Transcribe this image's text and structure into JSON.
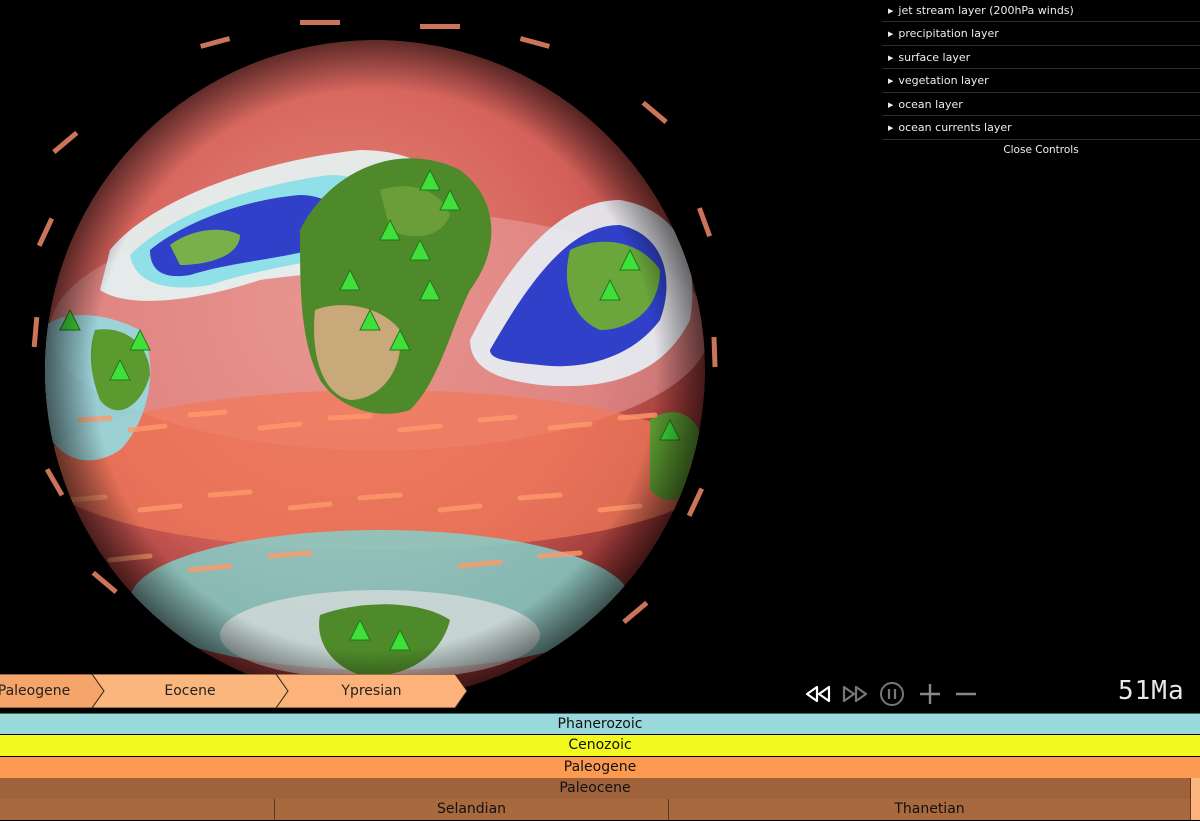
{
  "controls": {
    "layers": [
      {
        "label": "jet stream layer (200hPa winds)"
      },
      {
        "label": "precipitation layer"
      },
      {
        "label": "surface layer"
      },
      {
        "label": "vegetation layer"
      },
      {
        "label": "ocean layer"
      },
      {
        "label": "ocean currents layer"
      }
    ],
    "close_label": "Close Controls"
  },
  "breadcrumb": {
    "items": [
      "Paleogene",
      "Eocene",
      "Ypresian"
    ],
    "colors": [
      "#f5a46a",
      "#fbb67e",
      "#fcb27a"
    ]
  },
  "playback": {
    "buttons": [
      "rewind-icon",
      "fast-forward-icon",
      "pause-icon",
      "plus-icon",
      "minus-icon"
    ]
  },
  "time": {
    "readout": "51Ma"
  },
  "timescale": {
    "eon": {
      "label": "Phanerozoic",
      "color": "#9ad9db"
    },
    "era": {
      "label": "Cenozoic",
      "color": "#f2f91d"
    },
    "period": {
      "label": "Paleogene",
      "color": "#fd9a52"
    },
    "epoch": {
      "label": "Paleocene",
      "color": "#a0623a"
    },
    "ages": [
      {
        "label": "",
        "color": "#a8693f"
      },
      {
        "label": "Selandian",
        "color": "#a8693f"
      },
      {
        "label": "Thanetian",
        "color": "#a8693f"
      }
    ]
  },
  "colors": {
    "ocean_warm": "#d96a5a",
    "ocean_hot": "#f0795a",
    "land_green": "#4f8a2a",
    "desert": "#c9a87a",
    "precip_blue": "#3040c8",
    "precip_cyan": "#8fe0e8",
    "tree_green": "#3fe03a"
  }
}
